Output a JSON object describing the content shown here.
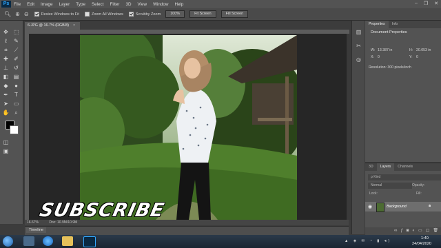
{
  "app": {
    "logo_text": "Ps"
  },
  "menu": [
    "File",
    "Edit",
    "Image",
    "Layer",
    "Type",
    "Select",
    "Filter",
    "3D",
    "View",
    "Window",
    "Help"
  ],
  "window_controls": [
    "–",
    "❐",
    "✕"
  ],
  "options": {
    "resize_windows_label": "Resize Windows to Fit",
    "zoom_all_label": "Zoom All Windows",
    "scrubby_zoom_label": "Scrubby Zoom",
    "zoom_value": "100%",
    "fit_screen_label": "Fit Screen",
    "fill_screen_label": "Fill Screen"
  },
  "document": {
    "tab_title": "6.JPG @ 16.7% (RGB/8)",
    "zoom_status": "16.67%",
    "doc_status": "Doc: 10.9M/10.9M"
  },
  "overlay": {
    "subscribe_text": "SUBSCRIBE"
  },
  "timeline": {
    "label": "Timeline"
  },
  "properties": {
    "tabs": [
      "Properties",
      "Info"
    ],
    "title": "Document Properties",
    "w_label": "W:",
    "w_value": "13.387 in",
    "h_label": "H:",
    "h_value": "20.053 in",
    "x_label": "X:",
    "x_value": "0",
    "y_label": "Y:",
    "y_value": "0",
    "resolution": "Resolution: 300 pixels/inch"
  },
  "layers": {
    "tabs": [
      "3D",
      "Layers",
      "Channels"
    ],
    "kind_placeholder": "ρ Kind",
    "blend_mode": "Normal",
    "opacity_label": "Opacity:",
    "lock_label": "Lock:",
    "fill_label": "Fill:",
    "layer_name": "Background"
  },
  "taskbar": {
    "time": "1:40",
    "date": "24/04/2020"
  },
  "colors": {
    "accent": "#31a8ff",
    "panel": "#535353",
    "workspace": "#262626"
  }
}
